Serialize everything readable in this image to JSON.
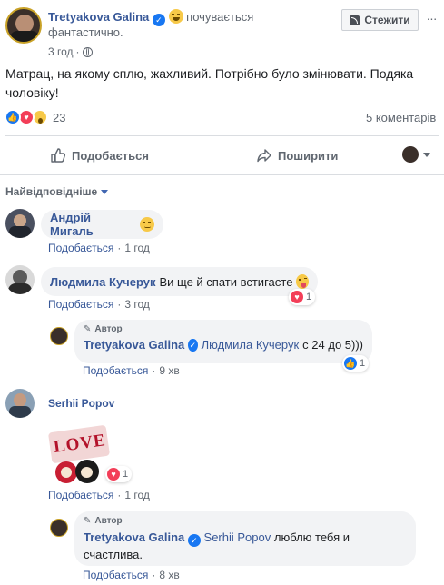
{
  "post": {
    "author": "Tretyakova Galina",
    "feeling": "почувається",
    "feeling_word": "фантастично.",
    "time": "3 год",
    "follow_label": "Стежити",
    "text": "Матрац, на якому сплю, жахливий. Потрібно було змінювати. Подяка чоловіку!",
    "reactions_count": "23",
    "comments_count": "5 коментарів"
  },
  "actions": {
    "like_label": "Подобається",
    "share_label": "Поширити"
  },
  "sort_label": "Найвідповідніше",
  "comments": [
    {
      "author": "Андрій Мигаль",
      "text": "",
      "like_label": "Подобається",
      "time": "1 год"
    },
    {
      "author": "Людмила Кучерук",
      "text": "Ви ще й спати встигаєте",
      "like_label": "Подобається",
      "time": "3 год",
      "reaction_count": "1",
      "reply": {
        "badge": "Автор",
        "author": "Tretyakova Galina",
        "mention": "Людмила Кучерук",
        "text": "с 24 до 5)))",
        "like_label": "Подобається",
        "time": "9 хв",
        "reaction_count": "1"
      }
    },
    {
      "author": "Serhii Popov",
      "sticker_text": "LOVE",
      "like_label": "Подобається",
      "time": "1 год",
      "reaction_count": "1",
      "reply": {
        "badge": "Автор",
        "author": "Tretyakova Galina",
        "mention": "Serhii Popov",
        "text": "люблю тебя и счастлива.",
        "like_label": "Подобається",
        "time": "8 хв"
      }
    }
  ],
  "colors": {
    "link": "#385898",
    "meta": "#606770",
    "bubble": "#f2f3f5",
    "like_blue": "#1877f2",
    "love_red": "#f33e58",
    "wow_yellow": "#f7c948"
  }
}
